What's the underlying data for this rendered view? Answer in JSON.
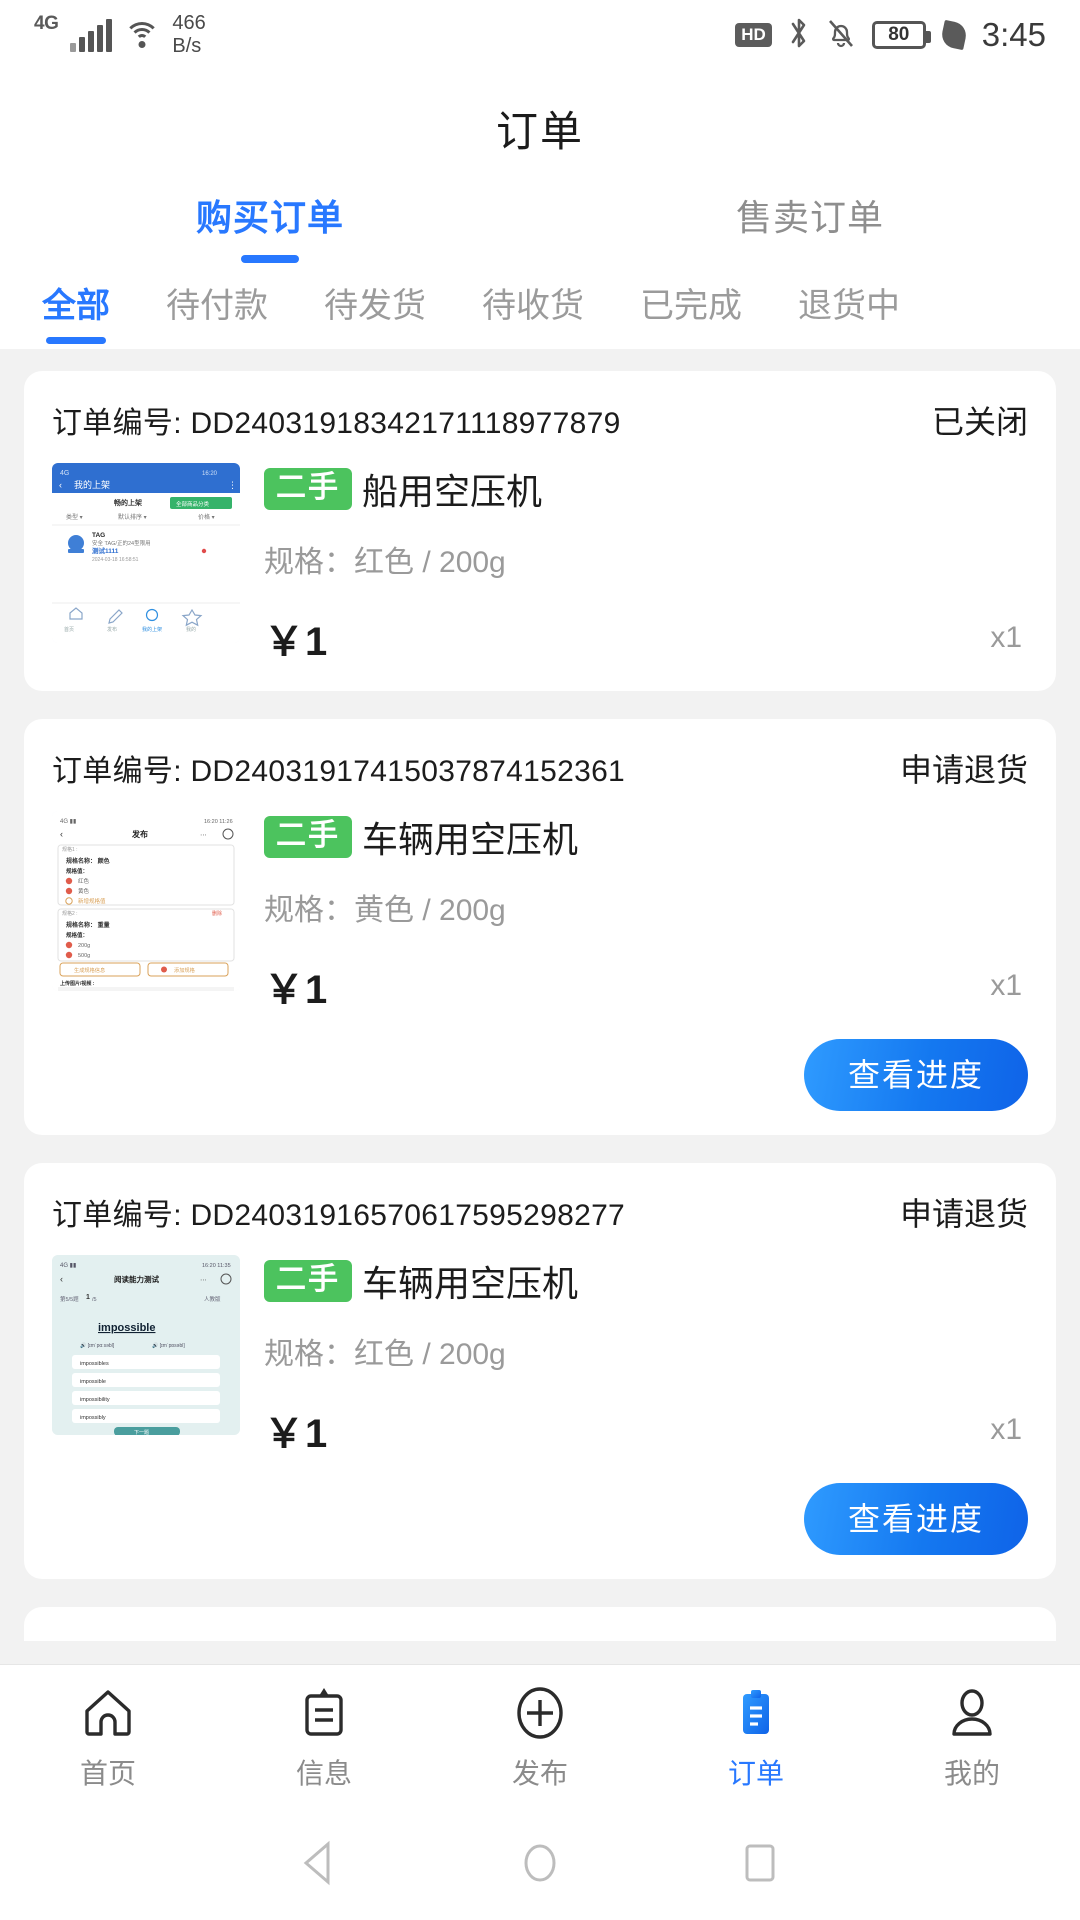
{
  "status_bar": {
    "network_type": "4G",
    "speed": "466\nB/s",
    "speed_value": "466",
    "speed_unit": "B/s",
    "hd_label": "HD",
    "battery_percent": "80",
    "time": "3:45",
    "icons": [
      "signal-bars-icon",
      "wifi-icon",
      "hd-icon",
      "bluetooth-icon",
      "mute-bell-icon",
      "battery-icon",
      "leaf-icon"
    ]
  },
  "header": {
    "title": "订单"
  },
  "top_tabs": [
    {
      "label": "购买订单",
      "active": true
    },
    {
      "label": "售卖订单",
      "active": false
    }
  ],
  "filter_tabs": [
    {
      "label": "全部",
      "active": true
    },
    {
      "label": "待付款",
      "active": false
    },
    {
      "label": "待发货",
      "active": false
    },
    {
      "label": "待收货",
      "active": false
    },
    {
      "label": "已完成",
      "active": false
    },
    {
      "label": "退货中",
      "active": false
    }
  ],
  "labels": {
    "order_no_prefix": "订单编号:",
    "spec_prefix": "规格：",
    "currency": "￥",
    "second_hand_badge": "二手"
  },
  "orders": [
    {
      "order_no_label": "订单编号: DD24031918342171118977879",
      "order_no": "DD24031918342171118977879",
      "status": "已关闭",
      "badge": "二手",
      "product": "船用空压机",
      "spec": "规格：红色 / 200g",
      "price": "￥1",
      "qty": "x1",
      "action": null,
      "thumb": "my-listings-screenshot"
    },
    {
      "order_no_label": "订单编号: DD24031917415037874152361",
      "order_no": "DD24031917415037874152361",
      "status": "申请退货",
      "badge": "二手",
      "product": "车辆用空压机",
      "spec": "规格：黄色 / 200g",
      "price": "￥1",
      "qty": "x1",
      "action": "查看进度",
      "thumb": "publish-form-screenshot"
    },
    {
      "order_no_label": "订单编号: DD24031916570617595298277",
      "order_no": "DD24031916570617595298277",
      "status": "申请退货",
      "badge": "二手",
      "product": "车辆用空压机",
      "spec": "规格：红色 / 200g",
      "price": "￥1",
      "qty": "x1",
      "action": "查看进度",
      "thumb": "vocabulary-quiz-screenshot"
    }
  ],
  "bottom_nav": [
    {
      "label": "首页",
      "icon": "home-icon",
      "active": false
    },
    {
      "label": "信息",
      "icon": "clipboard-lines-icon",
      "active": false
    },
    {
      "label": "发布",
      "icon": "plus-circle-icon",
      "active": false
    },
    {
      "label": "订单",
      "icon": "clipboard-filled-icon",
      "active": true
    },
    {
      "label": "我的",
      "icon": "person-icon",
      "active": false
    }
  ],
  "system_bar": [
    {
      "name": "back-triangle-icon"
    },
    {
      "name": "home-circle-icon"
    },
    {
      "name": "recents-square-icon"
    }
  ],
  "colors": {
    "accent": "#2878ff",
    "badge_green": "#4cc35e",
    "page_bg": "#f2f2f2",
    "muted_text": "#9a9a9a",
    "primary_text": "#1c1c1c"
  }
}
